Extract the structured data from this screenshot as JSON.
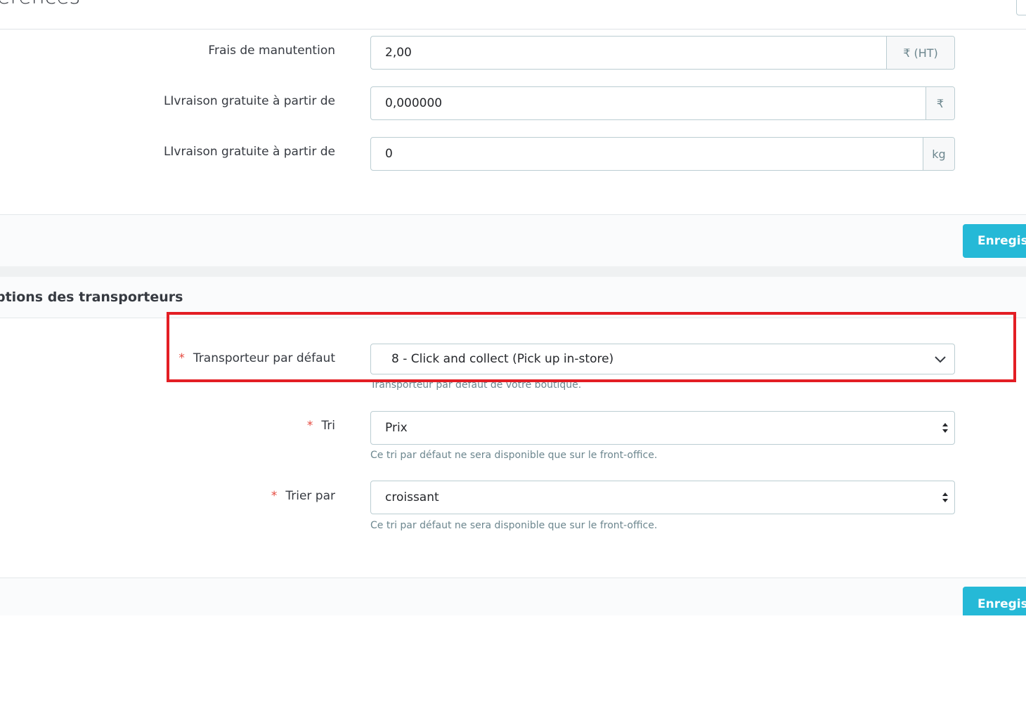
{
  "header": {
    "title": "érences"
  },
  "shipping_form": {
    "handling_fee": {
      "label": "Frais de manutention",
      "value": "2,00",
      "addon": "₹ (HT)"
    },
    "free_shipping_price": {
      "label": "LIvraison gratuite à partir de",
      "value": "0,000000",
      "addon": "₹"
    },
    "free_shipping_weight": {
      "label": "LIvraison gratuite à partir de",
      "value": "0",
      "addon": "kg"
    },
    "save_label": "Enregistrer"
  },
  "carrier_options": {
    "section_title": "ptions des transporteurs",
    "required_mark": "*",
    "default_carrier": {
      "label": "Transporteur par défaut",
      "value": "8 - Click and collect (Pick up in-store)",
      "help": "Transporteur par défaut de votre boutique."
    },
    "sort": {
      "label": "Tri",
      "value": "Prix",
      "help": "Ce tri par défaut ne sera disponible que sur le front-office."
    },
    "order": {
      "label": "Trier par",
      "value": "croissant",
      "help": "Ce tri par défaut ne sera disponible que sur le front-office."
    },
    "save_label": "Enregistrer"
  },
  "colors": {
    "primary_button": "#25b9d7",
    "highlight_border": "#e31e24",
    "required": "#e54a40"
  }
}
